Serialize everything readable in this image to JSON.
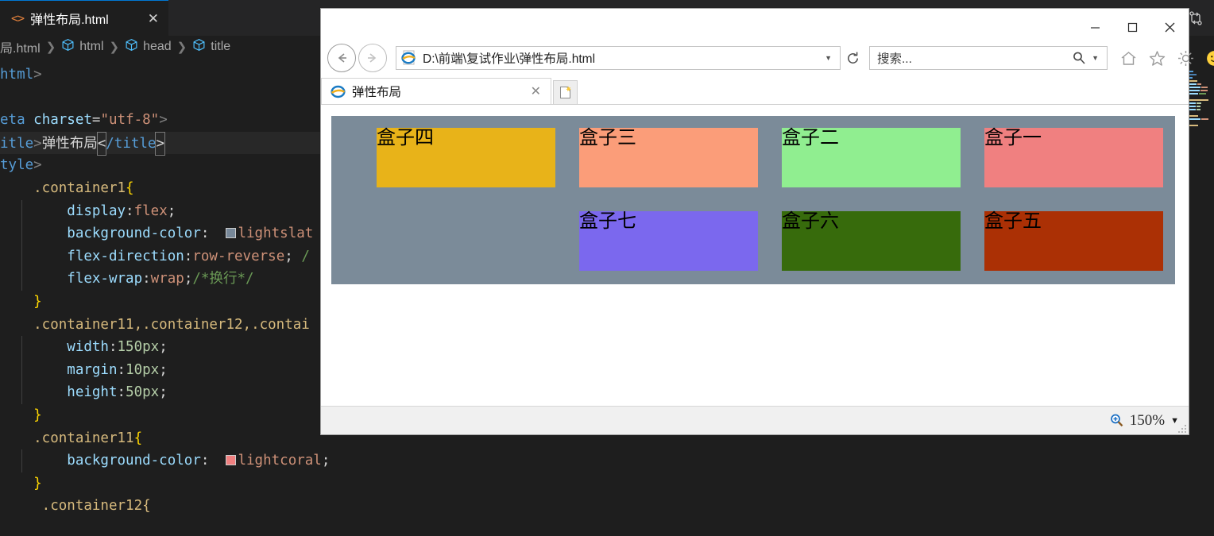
{
  "editor": {
    "tab": {
      "icon": "code-file-icon",
      "label": "弹性布局.html",
      "close": "✕"
    },
    "split_icon": "split-editor-icon",
    "breadcrumbs": [
      {
        "label": "局.html",
        "icon": null
      },
      {
        "label": "html",
        "icon": "symbol-cube-icon"
      },
      {
        "label": "head",
        "icon": "symbol-cube-icon"
      },
      {
        "label": "title",
        "icon": "symbol-cube-icon"
      }
    ],
    "breadcrumb_separator": "❯",
    "code_lines": [
      {
        "id": "line-html-open",
        "highlight": false,
        "tokens": [
          {
            "t": "html",
            "c": "tag"
          },
          {
            "t": ">",
            "c": "punct"
          }
        ]
      },
      {
        "id": "line-blank-1",
        "highlight": false,
        "tokens": []
      },
      {
        "id": "line-meta",
        "highlight": false,
        "tokens": [
          {
            "t": "eta ",
            "c": "tag"
          },
          {
            "t": "charset",
            "c": "attr"
          },
          {
            "t": "=",
            "c": "txt"
          },
          {
            "t": "\"utf-8\"",
            "c": "str"
          },
          {
            "t": ">",
            "c": "punct"
          }
        ]
      },
      {
        "id": "line-title",
        "highlight": true,
        "tokens": [
          {
            "t": "itle",
            "c": "tag"
          },
          {
            "t": ">",
            "c": "punct"
          },
          {
            "t": "弹性布局",
            "c": "txt"
          },
          {
            "t": "<",
            "c": "cursorbox"
          },
          {
            "t": "/title",
            "c": "tag"
          },
          {
            "t": ">",
            "c": "cursorbox"
          }
        ]
      },
      {
        "id": "line-style",
        "highlight": false,
        "tokens": [
          {
            "t": "tyle",
            "c": "tag"
          },
          {
            "t": ">",
            "c": "punct"
          }
        ]
      },
      {
        "id": "line-container1-open",
        "highlight": false,
        "indent": false,
        "tokens": [
          {
            "t": "    .container1",
            "c": "sel"
          },
          {
            "t": "{",
            "c": "brace"
          }
        ]
      },
      {
        "id": "line-display-flex",
        "highlight": false,
        "indent": true,
        "tokens": [
          {
            "t": "        display",
            "c": "prop"
          },
          {
            "t": ":",
            "c": "txt"
          },
          {
            "t": "flex",
            "c": "val"
          },
          {
            "t": ";",
            "c": "semi"
          }
        ]
      },
      {
        "id": "line-bg-lightslategray",
        "highlight": false,
        "indent": true,
        "tokens": [
          {
            "t": "        background-color",
            "c": "prop"
          },
          {
            "t": ":  ",
            "c": "txt"
          },
          {
            "t": "#778899",
            "c": "swatch"
          },
          {
            "t": "lightslat",
            "c": "val"
          }
        ]
      },
      {
        "id": "line-flex-direction",
        "highlight": false,
        "indent": true,
        "tokens": [
          {
            "t": "        flex-direction",
            "c": "prop"
          },
          {
            "t": ":",
            "c": "txt"
          },
          {
            "t": "row-reverse",
            "c": "val"
          },
          {
            "t": "; ",
            "c": "semi"
          },
          {
            "t": "/",
            "c": "cmt"
          }
        ]
      },
      {
        "id": "line-flex-wrap",
        "highlight": false,
        "indent": true,
        "tokens": [
          {
            "t": "        flex-wrap",
            "c": "prop"
          },
          {
            "t": ":",
            "c": "txt"
          },
          {
            "t": "wrap",
            "c": "val"
          },
          {
            "t": ";",
            "c": "semi"
          },
          {
            "t": "/*换行*/",
            "c": "cmt"
          }
        ]
      },
      {
        "id": "line-close-1",
        "highlight": false,
        "indent": false,
        "tokens": [
          {
            "t": "    }",
            "c": "brace"
          }
        ]
      },
      {
        "id": "line-containers-group",
        "highlight": false,
        "indent": false,
        "tokens": [
          {
            "t": "    .container11,.container12,.contai",
            "c": "sel"
          }
        ]
      },
      {
        "id": "line-width",
        "highlight": false,
        "indent": true,
        "tokens": [
          {
            "t": "        width",
            "c": "prop"
          },
          {
            "t": ":",
            "c": "txt"
          },
          {
            "t": "150px",
            "c": "num"
          },
          {
            "t": ";",
            "c": "semi"
          }
        ]
      },
      {
        "id": "line-margin",
        "highlight": false,
        "indent": true,
        "tokens": [
          {
            "t": "        margin",
            "c": "prop"
          },
          {
            "t": ":",
            "c": "txt"
          },
          {
            "t": "10px",
            "c": "num"
          },
          {
            "t": ";",
            "c": "semi"
          }
        ]
      },
      {
        "id": "line-height",
        "highlight": false,
        "indent": true,
        "tokens": [
          {
            "t": "        height",
            "c": "prop"
          },
          {
            "t": ":",
            "c": "txt"
          },
          {
            "t": "50px",
            "c": "num"
          },
          {
            "t": ";",
            "c": "semi"
          }
        ]
      },
      {
        "id": "line-close-2",
        "highlight": false,
        "indent": false,
        "tokens": [
          {
            "t": "    }",
            "c": "brace"
          }
        ]
      },
      {
        "id": "line-container11-open",
        "highlight": false,
        "indent": false,
        "tokens": [
          {
            "t": "    .container11",
            "c": "sel"
          },
          {
            "t": "{",
            "c": "brace"
          }
        ]
      },
      {
        "id": "line-bg-lightcoral",
        "highlight": false,
        "indent": true,
        "tokens": [
          {
            "t": "        background-color",
            "c": "prop"
          },
          {
            "t": ":  ",
            "c": "txt"
          },
          {
            "t": "#f08080",
            "c": "swatch"
          },
          {
            "t": "lightcoral",
            "c": "val"
          },
          {
            "t": ";",
            "c": "semi"
          }
        ]
      },
      {
        "id": "line-close-3",
        "highlight": false,
        "indent": false,
        "tokens": [
          {
            "t": "    }",
            "c": "brace"
          }
        ]
      },
      {
        "id": "line-container12-open",
        "highlight": false,
        "indent": false,
        "tokens": [
          {
            "t": "     .container12{",
            "c": "sel"
          }
        ]
      }
    ]
  },
  "browser": {
    "window_controls": {
      "minimize": "minimize-icon",
      "maximize": "maximize-icon",
      "close": "close-icon"
    },
    "nav": {
      "back": "back-arrow-icon",
      "forward": "forward-arrow-icon",
      "address_value": "D:\\前端\\复试作业\\弹性布局.html",
      "address_favicon": "ie-page-icon",
      "address_dropdown": "chevron-down-icon",
      "reload": "refresh-icon"
    },
    "search": {
      "placeholder": "搜索...",
      "icon": "search-icon",
      "dropdown": "chevron-down-icon"
    },
    "toolbar_icons": [
      {
        "name": "home-icon"
      },
      {
        "name": "favorites-star-icon"
      },
      {
        "name": "settings-gear-icon"
      },
      {
        "name": "smiley-feedback-icon"
      }
    ],
    "tab": {
      "favicon": "ie-logo-icon",
      "title": "弹性布局",
      "close": "✕"
    },
    "new_tab_icon": "new-tab-icon",
    "status": {
      "zoom_icon": "zoom-in-icon",
      "zoom_level": "150%",
      "zoom_dropdown": "▼"
    }
  },
  "page_content": {
    "container_background": "#7b8b99",
    "boxes": [
      {
        "label": "盒子一",
        "color": "#f08080",
        "order": 1
      },
      {
        "label": "盒子二",
        "color": "#90ee90",
        "order": 2
      },
      {
        "label": "盒子三",
        "color": "#fb9d79",
        "order": 3
      },
      {
        "label": "盒子四",
        "color": "#e8b319",
        "order": 4
      },
      {
        "label": "盒子五",
        "color": "#ab3005",
        "order": 5
      },
      {
        "label": "盒子六",
        "color": "#376b0c",
        "order": 6
      },
      {
        "label": "盒子七",
        "color": "#7b68ee",
        "order": 7
      }
    ]
  }
}
